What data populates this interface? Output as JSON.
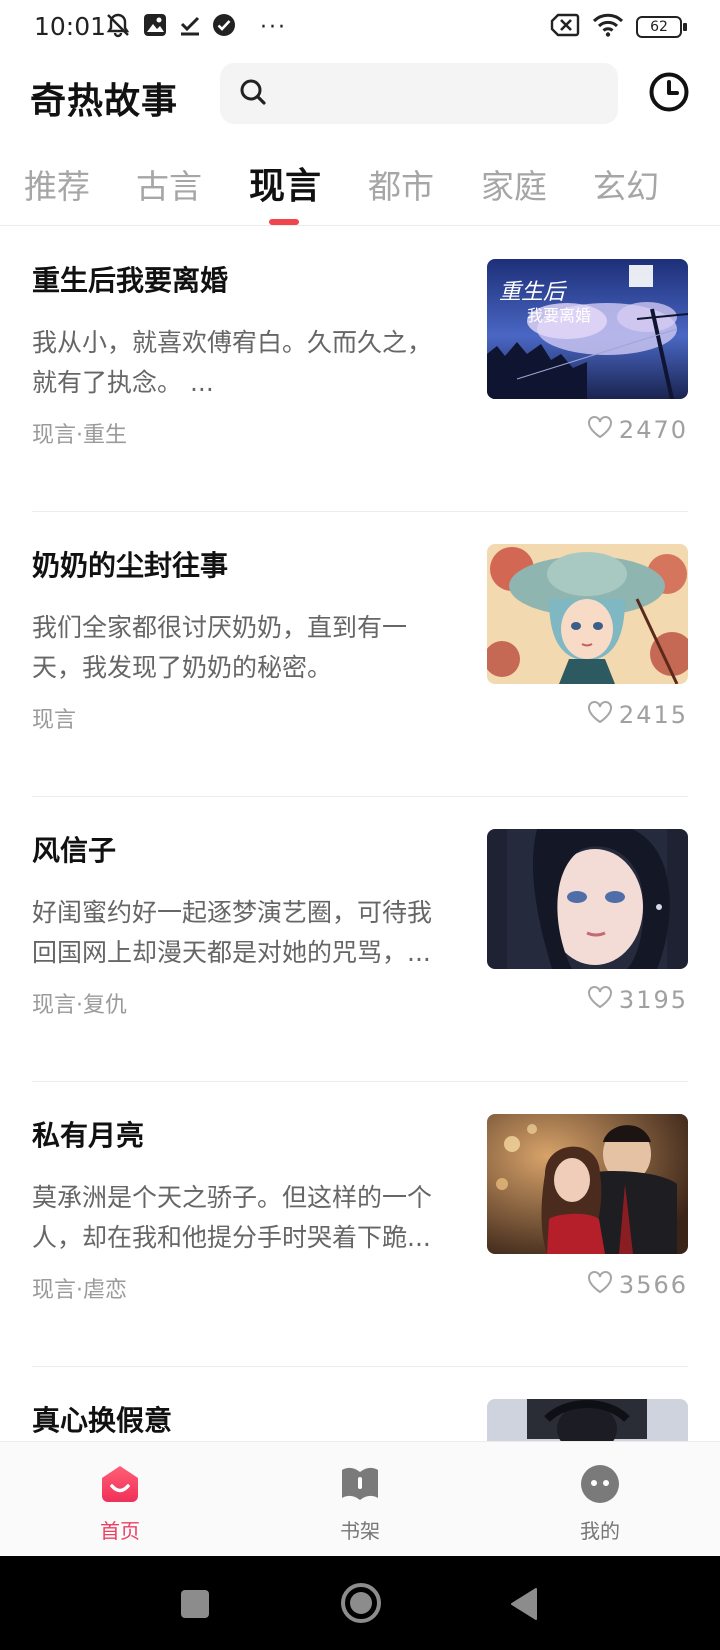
{
  "status_bar": {
    "time": "10:01",
    "left_icons": [
      "muted-bell-icon",
      "gallery-icon",
      "download-done-icon",
      "check-circle-icon"
    ],
    "more": "···",
    "battery": "62",
    "right_icons": [
      "sim-off-icon",
      "wifi-icon",
      "battery-icon"
    ]
  },
  "header": {
    "app_title": "奇热故事",
    "search_placeholder": "",
    "history_icon": "clock-icon"
  },
  "tabs": [
    {
      "label": "推荐",
      "active": false
    },
    {
      "label": "古言",
      "active": false
    },
    {
      "label": "现言",
      "active": true
    },
    {
      "label": "都市",
      "active": false
    },
    {
      "label": "家庭",
      "active": false
    },
    {
      "label": "玄幻",
      "active": false
    }
  ],
  "accent_color": "#f0444e",
  "stories": [
    {
      "title": "重生后我要离婚",
      "desc": "我从小，就喜欢傅宥白。久而久之，就有了执念。 ...",
      "tag": "现言·重生",
      "likes": "2470",
      "cover_text": "重生后我要离婚"
    },
    {
      "title": "奶奶的尘封往事",
      "desc": "我们全家都很讨厌奶奶，直到有一天，我发现了奶奶的秘密。",
      "tag": "现言",
      "likes": "2415"
    },
    {
      "title": "风信子",
      "desc": "好闺蜜约好一起逐梦演艺圈，可待我回国网上却漫天都是对她的咒骂，...",
      "tag": "现言·复仇",
      "likes": "3195"
    },
    {
      "title": "私有月亮",
      "desc": "莫承洲是个天之骄子。但这样的一个人，却在我和他提分手时哭着下跪...",
      "tag": "现言·虐恋",
      "likes": "3566"
    },
    {
      "title": "真心换假意",
      "desc": "",
      "tag": "",
      "likes": ""
    }
  ],
  "bottom_nav": [
    {
      "label": "首页",
      "icon": "home-smile-icon",
      "active": true
    },
    {
      "label": "书架",
      "icon": "bookshelf-icon",
      "active": false
    },
    {
      "label": "我的",
      "icon": "profile-face-icon",
      "active": false
    }
  ],
  "system_nav": [
    "recents-square-icon",
    "home-circle-icon",
    "back-triangle-icon"
  ]
}
